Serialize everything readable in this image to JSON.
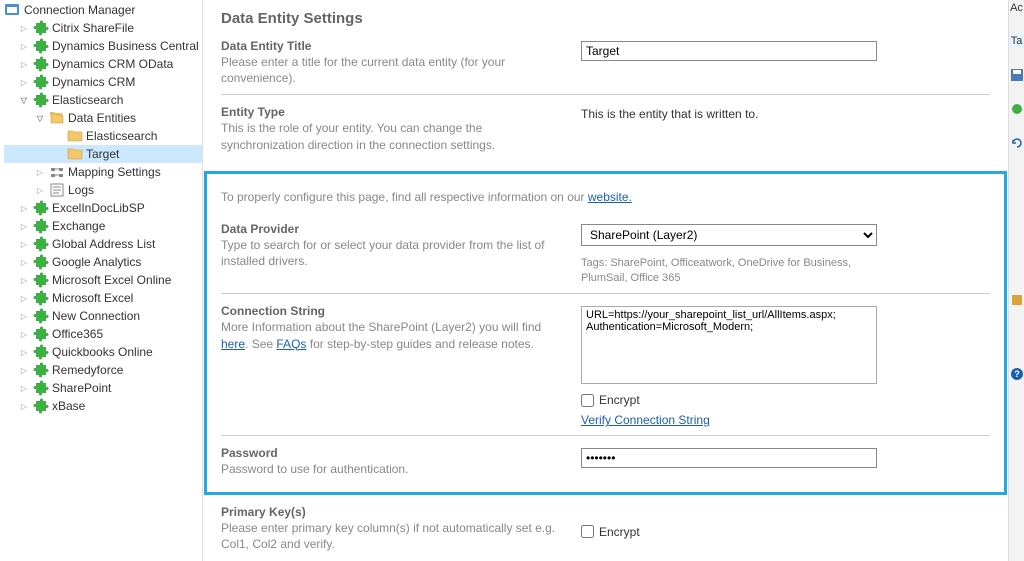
{
  "tree": {
    "root": "Connection Manager",
    "items": [
      {
        "label": "Citrix ShareFile",
        "icon": "puzzle",
        "indent": 1,
        "exp": "▷"
      },
      {
        "label": "Dynamics Business Central",
        "icon": "puzzle",
        "indent": 1,
        "exp": "▷"
      },
      {
        "label": "Dynamics CRM OData",
        "icon": "puzzle",
        "indent": 1,
        "exp": "▷"
      },
      {
        "label": "Dynamics CRM",
        "icon": "puzzle",
        "indent": 1,
        "exp": "▷"
      },
      {
        "label": "Elasticsearch",
        "icon": "puzzle",
        "indent": 1,
        "exp": "▽"
      },
      {
        "label": "Data Entities",
        "icon": "folder-group",
        "indent": 2,
        "exp": "▽"
      },
      {
        "label": "Elasticsearch",
        "icon": "folder",
        "indent": 3,
        "exp": ""
      },
      {
        "label": "Target",
        "icon": "folder",
        "indent": 3,
        "exp": "",
        "selected": true
      },
      {
        "label": "Mapping Settings",
        "icon": "mapping",
        "indent": 2,
        "exp": "▷"
      },
      {
        "label": "Logs",
        "icon": "logs",
        "indent": 2,
        "exp": "▷"
      },
      {
        "label": "ExcelInDocLibSP",
        "icon": "puzzle",
        "indent": 1,
        "exp": "▷"
      },
      {
        "label": "Exchange",
        "icon": "puzzle",
        "indent": 1,
        "exp": "▷"
      },
      {
        "label": "Global Address List",
        "icon": "puzzle",
        "indent": 1,
        "exp": "▷"
      },
      {
        "label": "Google Analytics",
        "icon": "puzzle",
        "indent": 1,
        "exp": "▷"
      },
      {
        "label": "Microsoft Excel Online",
        "icon": "puzzle",
        "indent": 1,
        "exp": "▷"
      },
      {
        "label": "Microsoft Excel",
        "icon": "puzzle",
        "indent": 1,
        "exp": "▷"
      },
      {
        "label": "New Connection",
        "icon": "puzzle",
        "indent": 1,
        "exp": "▷"
      },
      {
        "label": "Office365",
        "icon": "puzzle",
        "indent": 1,
        "exp": "▷"
      },
      {
        "label": "Quickbooks Online",
        "icon": "puzzle",
        "indent": 1,
        "exp": "▷"
      },
      {
        "label": "Remedyforce",
        "icon": "puzzle",
        "indent": 1,
        "exp": "▷"
      },
      {
        "label": "SharePoint",
        "icon": "puzzle",
        "indent": 1,
        "exp": "▷"
      },
      {
        "label": "xBase",
        "icon": "puzzle",
        "indent": 1,
        "exp": "▷"
      }
    ]
  },
  "page": {
    "title": "Data Entity Settings",
    "entity_title": {
      "label": "Data Entity Title",
      "desc": "Please enter a title for the current data entity (for your convenience).",
      "value": "Target"
    },
    "entity_type": {
      "label": "Entity Type",
      "desc": "This is the role of your entity. You can change the synchronization direction in the connection settings.",
      "value": "This is the entity that is written to."
    },
    "notice_prefix": "To properly configure this page, find all respective information on our ",
    "notice_link": "website.",
    "provider": {
      "label": "Data Provider",
      "desc": "Type to search for or select your data provider from the list of installed drivers.",
      "value": "SharePoint (Layer2)",
      "tags": "Tags: SharePoint, Officeatwork, OneDrive for Business, PlumSail, Office 365"
    },
    "conn": {
      "label": "Connection String",
      "desc_pre": "More Information about the SharePoint (Layer2) you will find ",
      "here": "here",
      "desc_mid": ". See ",
      "faq": "FAQs",
      "desc_post": " for step-by-step guides and release notes.",
      "value": "URL=https://your_sharepoint_list_url/AllItems.aspx;\nAuthentication=Microsoft_Modern;",
      "encrypt": "Encrypt",
      "verify": "Verify Connection String"
    },
    "password": {
      "label": "Password",
      "desc": "Password to use for authentication.",
      "value": "•••••••"
    },
    "primary": {
      "label": "Primary Key(s)",
      "desc": "Please enter primary key column(s) if not automatically set e.g. Col1, Col2 and verify.",
      "encrypt": "Encrypt"
    }
  },
  "right": {
    "ac": "Ac",
    "ta": "Ta"
  }
}
